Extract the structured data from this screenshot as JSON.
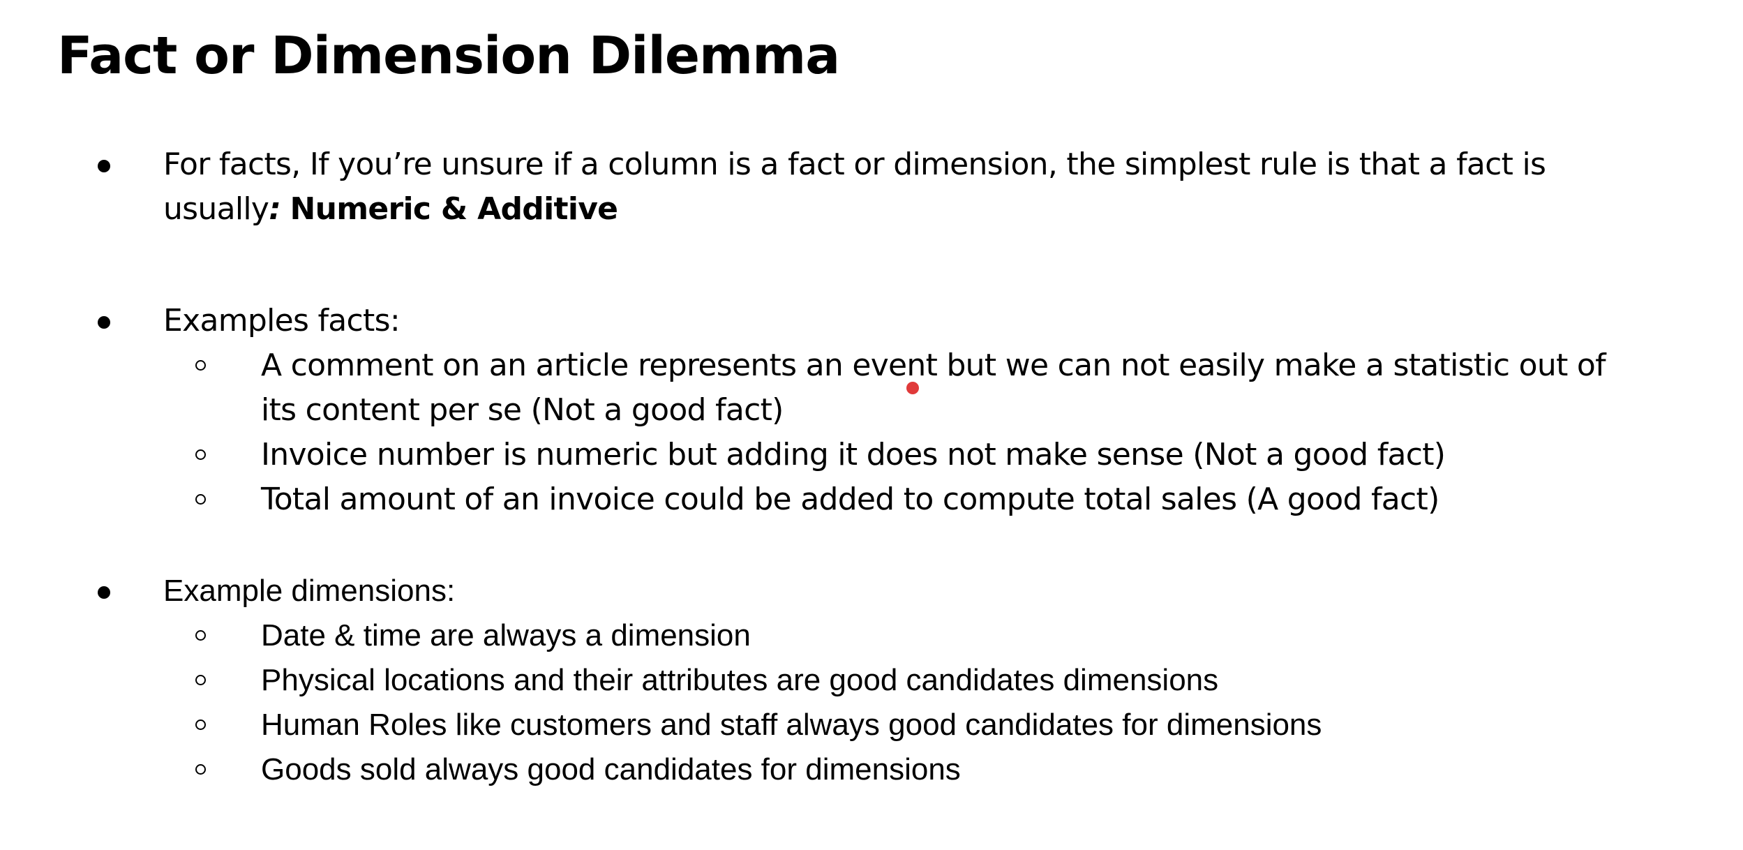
{
  "title": "Fact or Dimension Dilemma",
  "colors": {
    "text": "#000000",
    "background": "#ffffff",
    "pointer": "#e03a3a"
  },
  "bullets": [
    {
      "line1": "For facts, If you’re unsure if a column is a fact or dimension, the simplest rule is that a fact is",
      "line2_prefix": "usually",
      "line2_colon": ":",
      "line2_bold": "Numeric & Additive"
    },
    {
      "label": "Examples facts:",
      "items": [
        {
          "line1": "A comment on an article represents an event but we can not easily make a statistic out of",
          "line2": "its content per se (Not a good fact)"
        },
        {
          "line1": "Invoice number is numeric but adding it does not make sense (Not a good fact)"
        },
        {
          "line1": "Total amount of an invoice could be added to compute total sales (A good fact)"
        }
      ]
    },
    {
      "label": "Example dimensions:",
      "items": [
        "Date & time are always a dimension",
        "Physical locations and their attributes are good candidates dimensions",
        "Human Roles like customers and staff always good candidates for dimensions",
        "Goods sold always good candidates for dimensions"
      ]
    }
  ]
}
